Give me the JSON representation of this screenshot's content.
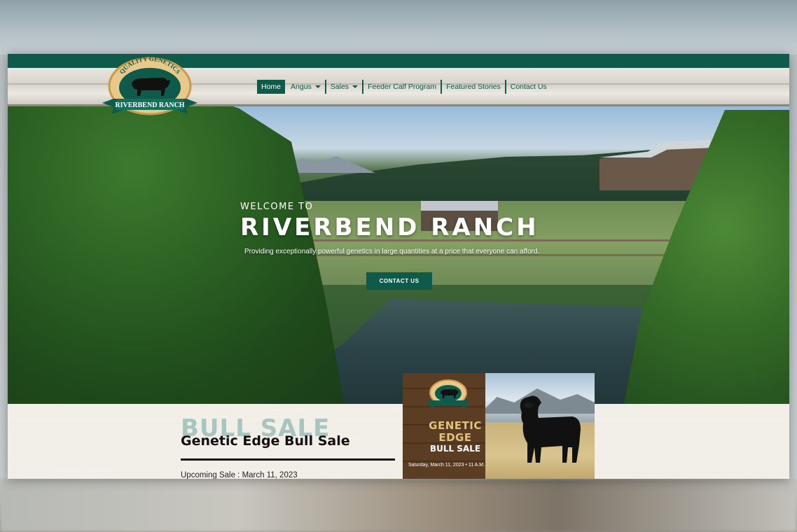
{
  "logo": {
    "arc_text": "QUALITY GENETICS",
    "banner_text": "RIVERBEND RANCH"
  },
  "nav": {
    "items": [
      {
        "label": "Home",
        "active": true
      },
      {
        "label": "Angus",
        "dropdown": true
      },
      {
        "label": "Sales",
        "dropdown": true
      },
      {
        "label": "Feeder Calf Program"
      },
      {
        "label": "Featured Stories"
      },
      {
        "label": "Contact Us"
      }
    ]
  },
  "hero": {
    "welcome": "WELCOME TO",
    "title": "RIVERBEND RANCH",
    "tagline": "Providing exceptionally powerful genetics in large quantities at a price that everyone can afford.",
    "cta": "CONTACT US"
  },
  "sale": {
    "ghost_title": "BULL SALE",
    "title": "Genetic Edge Bull Sale",
    "upcoming": "Upcoming Sale : March 11, 2023"
  },
  "promo": {
    "line1": "GENETIC",
    "line2": "EDGE",
    "line3": "BULL SALE",
    "date": "Saturday, March 11, 2023 • 11 A.M."
  },
  "colors": {
    "brand_green": "#0e5a4b",
    "gold": "#e3c27a",
    "paper": "#f3f0ea"
  }
}
